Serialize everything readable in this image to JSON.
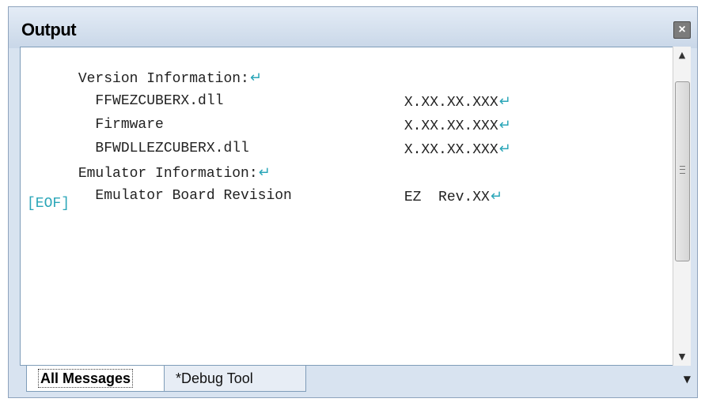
{
  "panel": {
    "title": "Output",
    "close_icon": "close-icon"
  },
  "output": {
    "lines": [
      {
        "label": "Version Information:",
        "value": ""
      },
      {
        "label": "  FFWEZCUBERX.dll",
        "value": "X.XX.XX.XXX"
      },
      {
        "label": "  Firmware",
        "value": "X.XX.XX.XXX"
      },
      {
        "label": "  BFWDLLEZCUBERX.dll",
        "value": "X.XX.XX.XXX"
      },
      {
        "label": "Emulator Information:",
        "value": ""
      },
      {
        "label": "  Emulator Board Revision",
        "value": "EZ  Rev.XX"
      }
    ],
    "eof": "[EOF]",
    "newline_glyph": "↵"
  },
  "tabs": [
    {
      "label": "All Messages",
      "active": true
    },
    {
      "label": "*Debug Tool",
      "active": false
    }
  ],
  "colors": {
    "accent_newline": "#2aa6b8",
    "panel_bg": "#d8e3f0"
  }
}
